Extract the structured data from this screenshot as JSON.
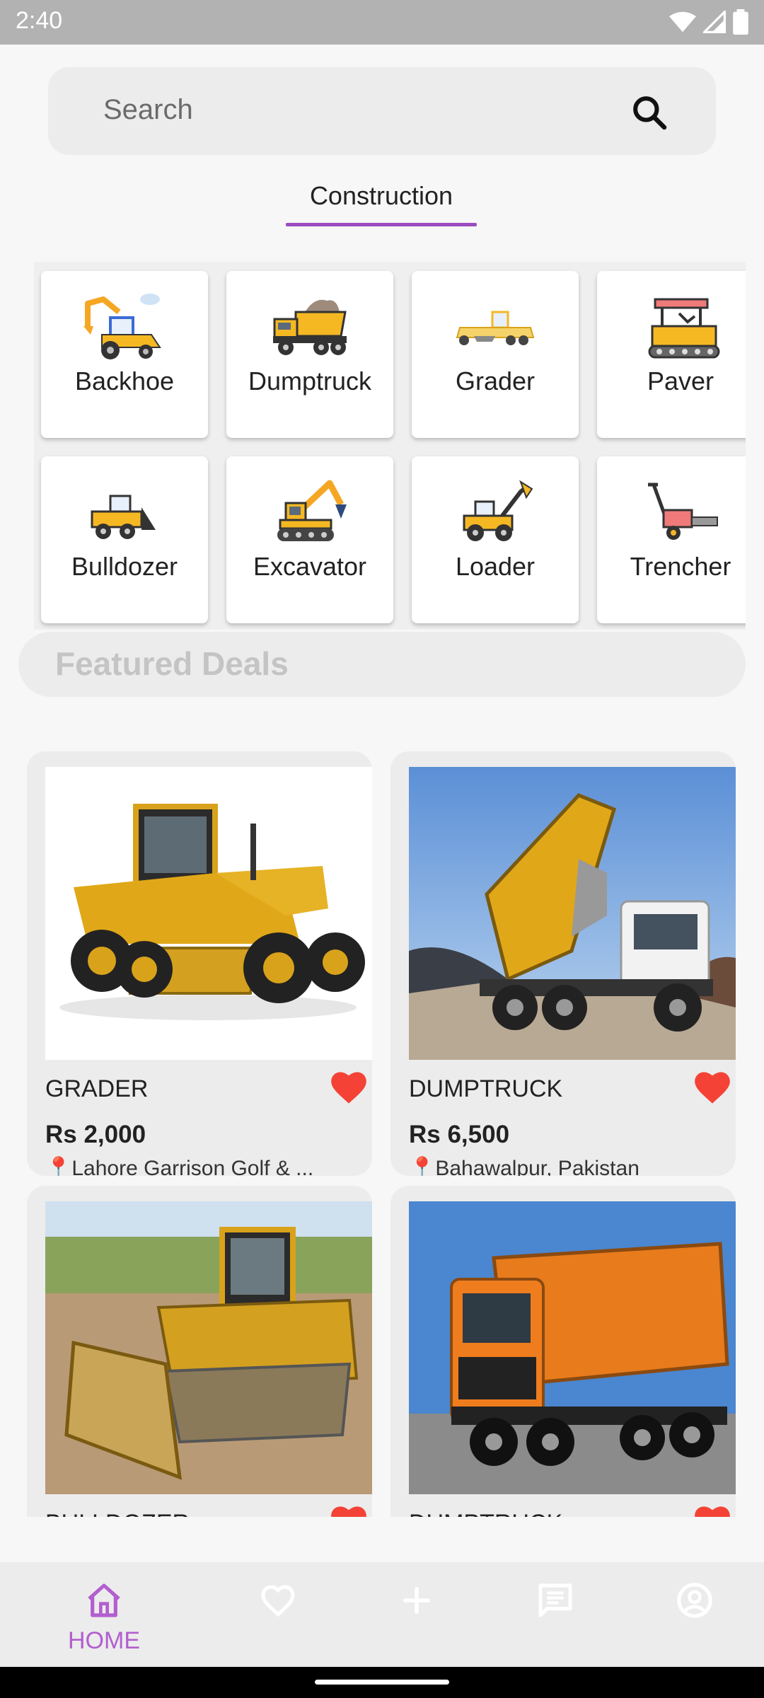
{
  "status_bar": {
    "time": "2:40"
  },
  "search": {
    "placeholder": "Search"
  },
  "tabs": [
    {
      "label": "Construction"
    }
  ],
  "categories": [
    {
      "label": "Backhoe",
      "icon": "backhoe-icon"
    },
    {
      "label": "Dumptruck",
      "icon": "dumptruck-icon"
    },
    {
      "label": "Grader",
      "icon": "grader-icon"
    },
    {
      "label": "Paver",
      "icon": "paver-icon"
    },
    {
      "label": "Bulldozer",
      "icon": "bulldozer-icon"
    },
    {
      "label": "Excavator",
      "icon": "excavator-icon"
    },
    {
      "label": "Loader",
      "icon": "loader-icon"
    },
    {
      "label": "Trencher",
      "icon": "trencher-icon"
    }
  ],
  "featured": {
    "title": "Featured Deals",
    "deals": [
      {
        "name": "GRADER",
        "price": "Rs 2,000",
        "location": "Lahore Garrison Golf & ...",
        "favorited": true
      },
      {
        "name": "DUMPTRUCK",
        "price": "Rs 6,500",
        "location": "Bahawalpur, Pakistan",
        "favorited": true
      },
      {
        "name": "BULLDOZER",
        "favorited": true
      },
      {
        "name": "DUMPTRUCK",
        "favorited": true
      }
    ]
  },
  "bottom_nav": [
    {
      "label": "HOME",
      "icon": "home-icon",
      "active": true
    },
    {
      "label": "",
      "icon": "heart-icon"
    },
    {
      "label": "",
      "icon": "plus-icon"
    },
    {
      "label": "",
      "icon": "chat-icon"
    },
    {
      "label": "",
      "icon": "account-icon"
    }
  ],
  "colors": {
    "accent": "#9b4dbf",
    "nav_active": "#b25fcf",
    "heart": "#f44336",
    "machine_yellow": "#f5b823"
  }
}
